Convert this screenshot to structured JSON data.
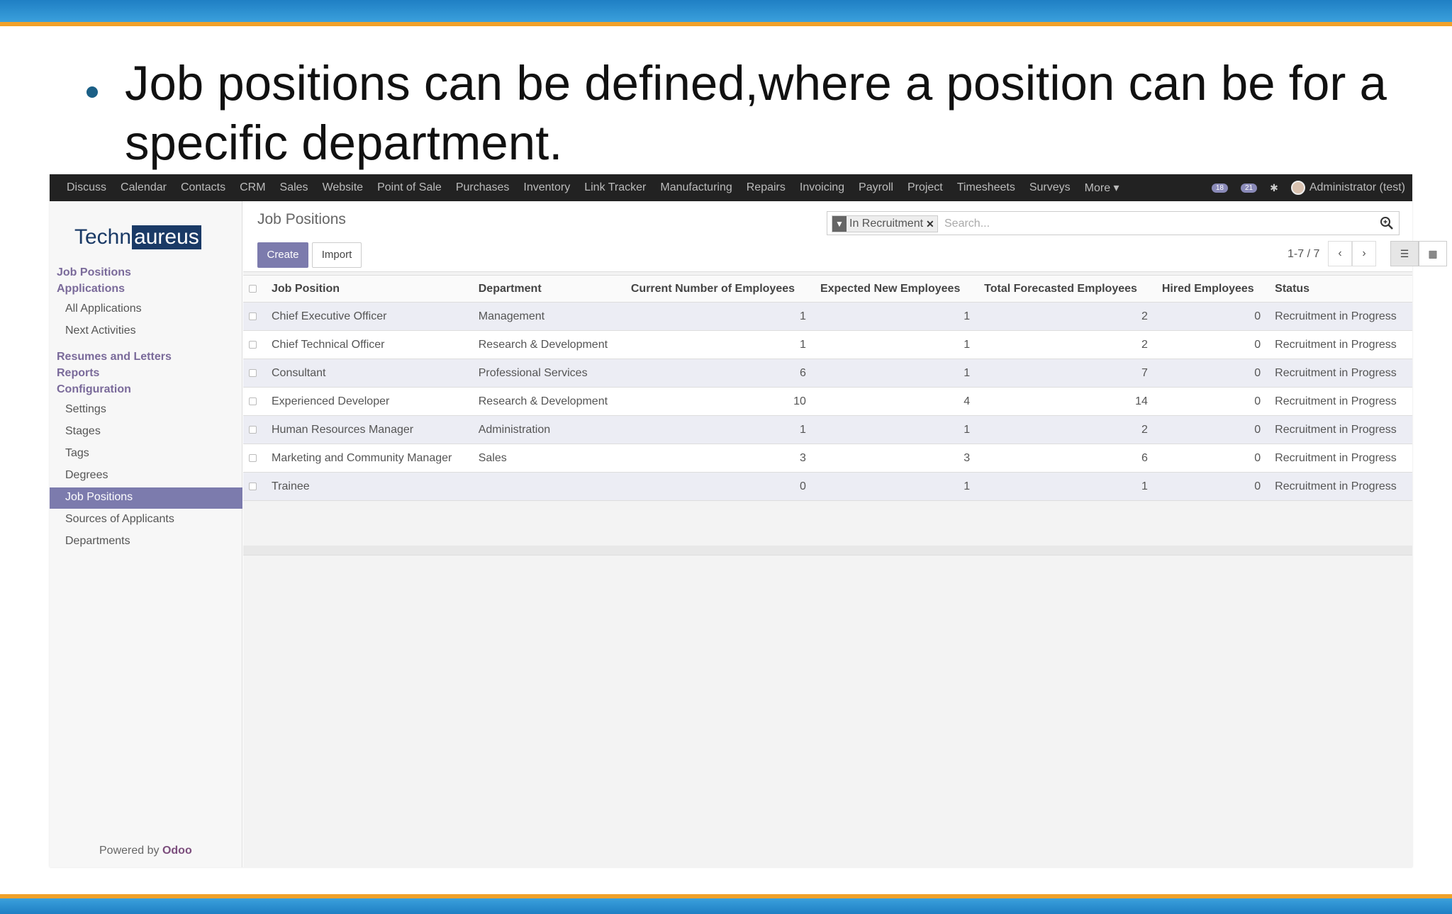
{
  "slide": {
    "headline": "Job positions can be defined,where a position can be for a specific department."
  },
  "topnav": {
    "menus": [
      "Discuss",
      "Calendar",
      "Contacts",
      "CRM",
      "Sales",
      "Website",
      "Point of Sale",
      "Purchases",
      "Inventory",
      "Link Tracker",
      "Manufacturing",
      "Repairs",
      "Invoicing",
      "Payroll",
      "Project",
      "Timesheets",
      "Surveys",
      "More ▾"
    ],
    "badge_messages": "18",
    "badge_activities": "21",
    "user": "Administrator (test)"
  },
  "logo": {
    "part1": "Techn",
    "part2": "aureus"
  },
  "sidebar": {
    "sections": [
      {
        "head": "Job Positions",
        "items": []
      },
      {
        "head": "Applications",
        "items": [
          "All Applications",
          "Next Activities"
        ]
      },
      {
        "head": "Resumes and Letters",
        "items": []
      },
      {
        "head": "Reports",
        "items": []
      },
      {
        "head": "Configuration",
        "items": [
          "Settings",
          "Stages",
          "Tags",
          "Degrees",
          "Job Positions",
          "Sources of Applicants",
          "Departments"
        ]
      }
    ],
    "active": "Job Positions",
    "powered_prefix": "Powered by",
    "powered_brand": "Odoo"
  },
  "control_panel": {
    "breadcrumb": "Job Positions",
    "create_label": "Create",
    "import_label": "Import",
    "facet_label": "In Recruitment",
    "search_placeholder": "Search...",
    "pager": "1-7 / 7"
  },
  "table": {
    "columns": [
      "Job Position",
      "Department",
      "Current Number of Employees",
      "Expected New Employees",
      "Total Forecasted Employees",
      "Hired Employees",
      "Status"
    ],
    "rows": [
      [
        "Chief Executive Officer",
        "Management",
        "1",
        "1",
        "2",
        "0",
        "Recruitment in Progress"
      ],
      [
        "Chief Technical Officer",
        "Research & Development",
        "1",
        "1",
        "2",
        "0",
        "Recruitment in Progress"
      ],
      [
        "Consultant",
        "Professional Services",
        "6",
        "1",
        "7",
        "0",
        "Recruitment in Progress"
      ],
      [
        "Experienced Developer",
        "Research & Development",
        "10",
        "4",
        "14",
        "0",
        "Recruitment in Progress"
      ],
      [
        "Human Resources Manager",
        "Administration",
        "1",
        "1",
        "2",
        "0",
        "Recruitment in Progress"
      ],
      [
        "Marketing and Community Manager",
        "Sales",
        "3",
        "3",
        "6",
        "0",
        "Recruitment in Progress"
      ],
      [
        "Trainee",
        "",
        "0",
        "1",
        "1",
        "0",
        "Recruitment in Progress"
      ]
    ]
  },
  "colors": {
    "accent": "#7c7bad",
    "topbar": "#222222",
    "slide_band": "#2a8fd0",
    "slide_edge": "#f0a12a"
  },
  "icons": {
    "bullet": "bullet-dot-icon",
    "filter": "filter-icon",
    "remove_facet": "close-icon",
    "search": "search-icon",
    "prev": "chevron-left-icon",
    "next": "chevron-right-icon",
    "list_view": "list-view-icon",
    "kanban_view": "kanban-view-icon"
  }
}
